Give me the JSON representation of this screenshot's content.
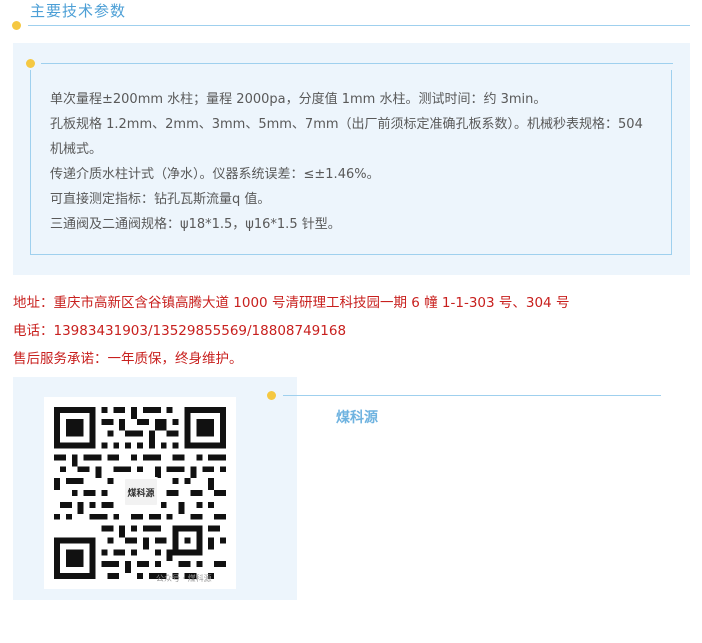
{
  "section": {
    "title": "主要技术参数"
  },
  "specs": {
    "lines": [
      "单次量程±200mm 水柱；量程 2000pa，分度值 1mm 水柱。测试时间：约 3min。",
      "孔板规格 1.2mm、2mm、3mm、5mm、7mm（出厂前须标定准确孔板系数）。机械秒表规格：504 机械式。",
      "传递介质水柱计式（净水）。仪器系统误差：≤±1.46%。",
      "可直接测定指标：钻孔瓦斯流量q 值。",
      "三通阀及二通阀规格：ψ18*1.5，ψ16*1.5 针型。"
    ]
  },
  "contact": {
    "address": "地址：重庆市高新区含谷镇高腾大道 1000 号清研理工科技园一期 6 幢 1-1-303 号、304 号",
    "phone": "电话：13983431903/13529855569/18808749168",
    "service": "售后服务承诺：一年质保，终身维护。"
  },
  "brand": {
    "name": "煤科源",
    "qr_logo_text": "煤科源",
    "qr_watermark": "公众号 · 煤科源"
  },
  "colors": {
    "accent_blue": "#4c9fd6",
    "line_blue": "#9fd0ee",
    "panel_bg": "#edf5fc",
    "dot_yellow": "#f5c842",
    "contact_red": "#c8201e"
  }
}
